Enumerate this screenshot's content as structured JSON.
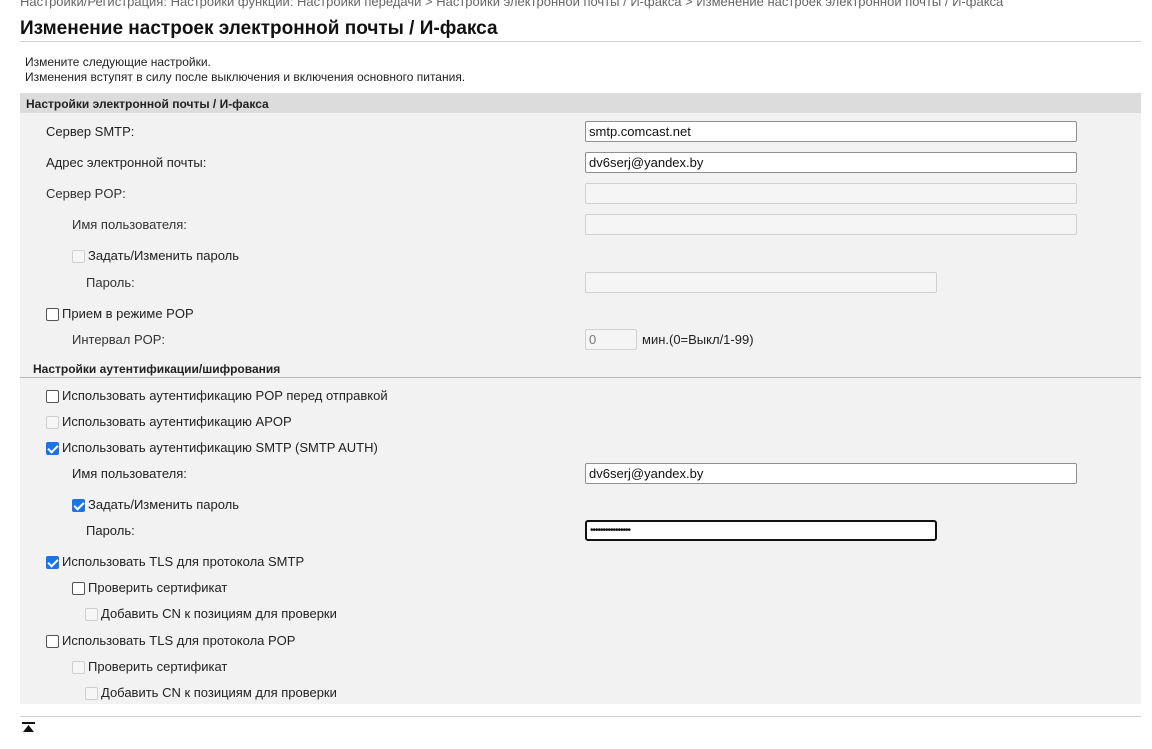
{
  "breadcrumb": "Настройки/Регистрация: Настройки функции: Настройки передачи > Настройки электронной почты / И-факса > Изменение настроек электронной почты / И-факса",
  "page_title": "Изменение настроек электронной почты / И-факса",
  "intro": {
    "line1": "Измените следующие настройки.",
    "line2": "Изменения вступят в силу после выключения и включения основного питания."
  },
  "email_section": {
    "header": "Настройки электронной почты / И-факса",
    "smtp_server_label": "Сервер SMTP:",
    "smtp_server_value": "smtp.comcast.net",
    "email_label": "Адрес электронной почты:",
    "email_value": "dv6serj@yandex.by",
    "pop_server_label": "Сервер POP:",
    "pop_server_value": "",
    "pop_user_label": "Имя пользователя:",
    "pop_user_value": "",
    "pop_set_password_label": "Задать/Изменить пароль",
    "pop_password_label": "Пароль:",
    "pop_password_value": "",
    "pop_receive_label": "Прием в режиме POP",
    "pop_interval_label": "Интервал POP:",
    "pop_interval_value": "0",
    "pop_interval_unit": "мин.(0=Выкл/1-99)"
  },
  "auth_section": {
    "header": "Настройки аутентификации/шифрования",
    "pop_before_smtp_label": "Использовать аутентификацию POP перед отправкой",
    "apop_label": "Использовать аутентификацию APOP",
    "smtp_auth_label": "Использовать аутентификацию SMTP (SMTP AUTH)",
    "smtp_user_label": "Имя пользователя:",
    "smtp_user_value": "dv6serj@yandex.by",
    "smtp_set_password_label": "Задать/Изменить пароль",
    "smtp_password_label": "Пароль:",
    "smtp_password_value": "••••••••••••••••",
    "tls_smtp_label": "Использовать TLS для протокола SMTP",
    "tls_smtp_verify_label": "Проверить сертификат",
    "tls_smtp_cn_label": "Добавить CN к позициям для проверки",
    "tls_pop_label": "Использовать TLS для протокола POP",
    "tls_pop_verify_label": "Проверить сертификат",
    "tls_pop_cn_label": "Добавить CN к позициям для проверки"
  },
  "icons": {
    "back_to_top": "back-to-top-icon"
  }
}
